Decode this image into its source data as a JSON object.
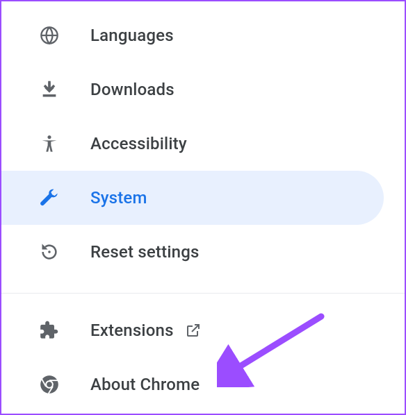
{
  "nav": {
    "items": [
      {
        "id": "languages",
        "label": "Languages",
        "icon": "globe",
        "selected": false
      },
      {
        "id": "downloads",
        "label": "Downloads",
        "icon": "download",
        "selected": false
      },
      {
        "id": "accessibility",
        "label": "Accessibility",
        "icon": "accessibility",
        "selected": false
      },
      {
        "id": "system",
        "label": "System",
        "icon": "wrench",
        "selected": true
      },
      {
        "id": "reset",
        "label": "Reset settings",
        "icon": "reset",
        "selected": false
      }
    ],
    "footer": [
      {
        "id": "extensions",
        "label": "Extensions",
        "icon": "puzzle",
        "external": true
      },
      {
        "id": "about",
        "label": "About Chrome",
        "icon": "chrome",
        "external": false
      }
    ]
  },
  "colors": {
    "accent": "#1a73e8",
    "selected_bg": "#e8f0fe",
    "text": "#3c4043",
    "icon": "#5f6368",
    "annotation_arrow": "#9b4dff"
  },
  "annotation": {
    "type": "arrow",
    "points_to": "about"
  }
}
